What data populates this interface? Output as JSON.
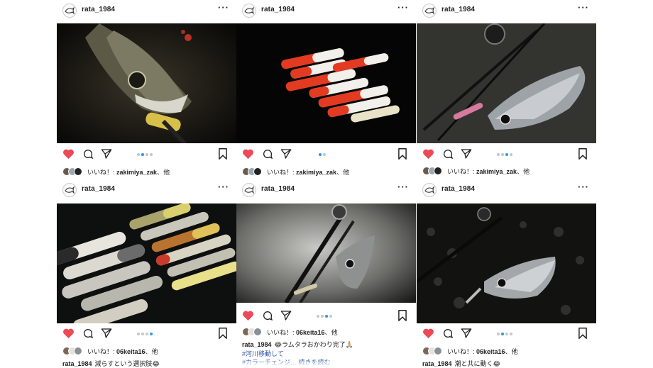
{
  "posts": [
    {
      "username": "rata_1984",
      "more": "···",
      "likes_prefix": "いいね！: ",
      "likes_user": "zakimiya_zak",
      "likes_suffix": "、他",
      "caption": ""
    },
    {
      "username": "rata_1984",
      "more": "···",
      "likes_prefix": "いいね！: ",
      "likes_user": "zakimiya_zak",
      "likes_suffix": "、他",
      "caption": ""
    },
    {
      "username": "rata_1984",
      "more": "···",
      "likes_prefix": "いいね！: ",
      "likes_user": "zakimiya_zak",
      "likes_suffix": "、他",
      "caption": ""
    },
    {
      "username": "rata_1984",
      "more": "···",
      "likes_prefix": "いいね！: ",
      "likes_user": "06keita16",
      "likes_suffix": "、他",
      "caption_user": "rata_1984",
      "caption": "減らすという選択肢😂"
    },
    {
      "username": "rata_1984",
      "more": "···",
      "likes_prefix": "いいね！: ",
      "likes_user": "06keita16",
      "likes_suffix": "、他",
      "caption_user": "rata_1984",
      "caption": "😂ラムタラおかわり完了🙏🏼",
      "hashtags": [
        "#河川移動して",
        "#カラーチェンジ… 続きを読む"
      ]
    },
    {
      "username": "rata_1984",
      "more": "···",
      "likes_prefix": "いいね！: ",
      "likes_user": "06keita16",
      "likes_suffix": "、他",
      "caption_user": "rata_1984",
      "caption": "潮と共に動く😂"
    }
  ],
  "colors": {
    "heart": "#ed4956",
    "link": "#2a4fa8",
    "active_dot": "#3897f0"
  },
  "icons": [
    "user-avatar-icon",
    "more-icon",
    "heart-icon",
    "comment-icon",
    "share-icon",
    "bookmark-icon"
  ]
}
